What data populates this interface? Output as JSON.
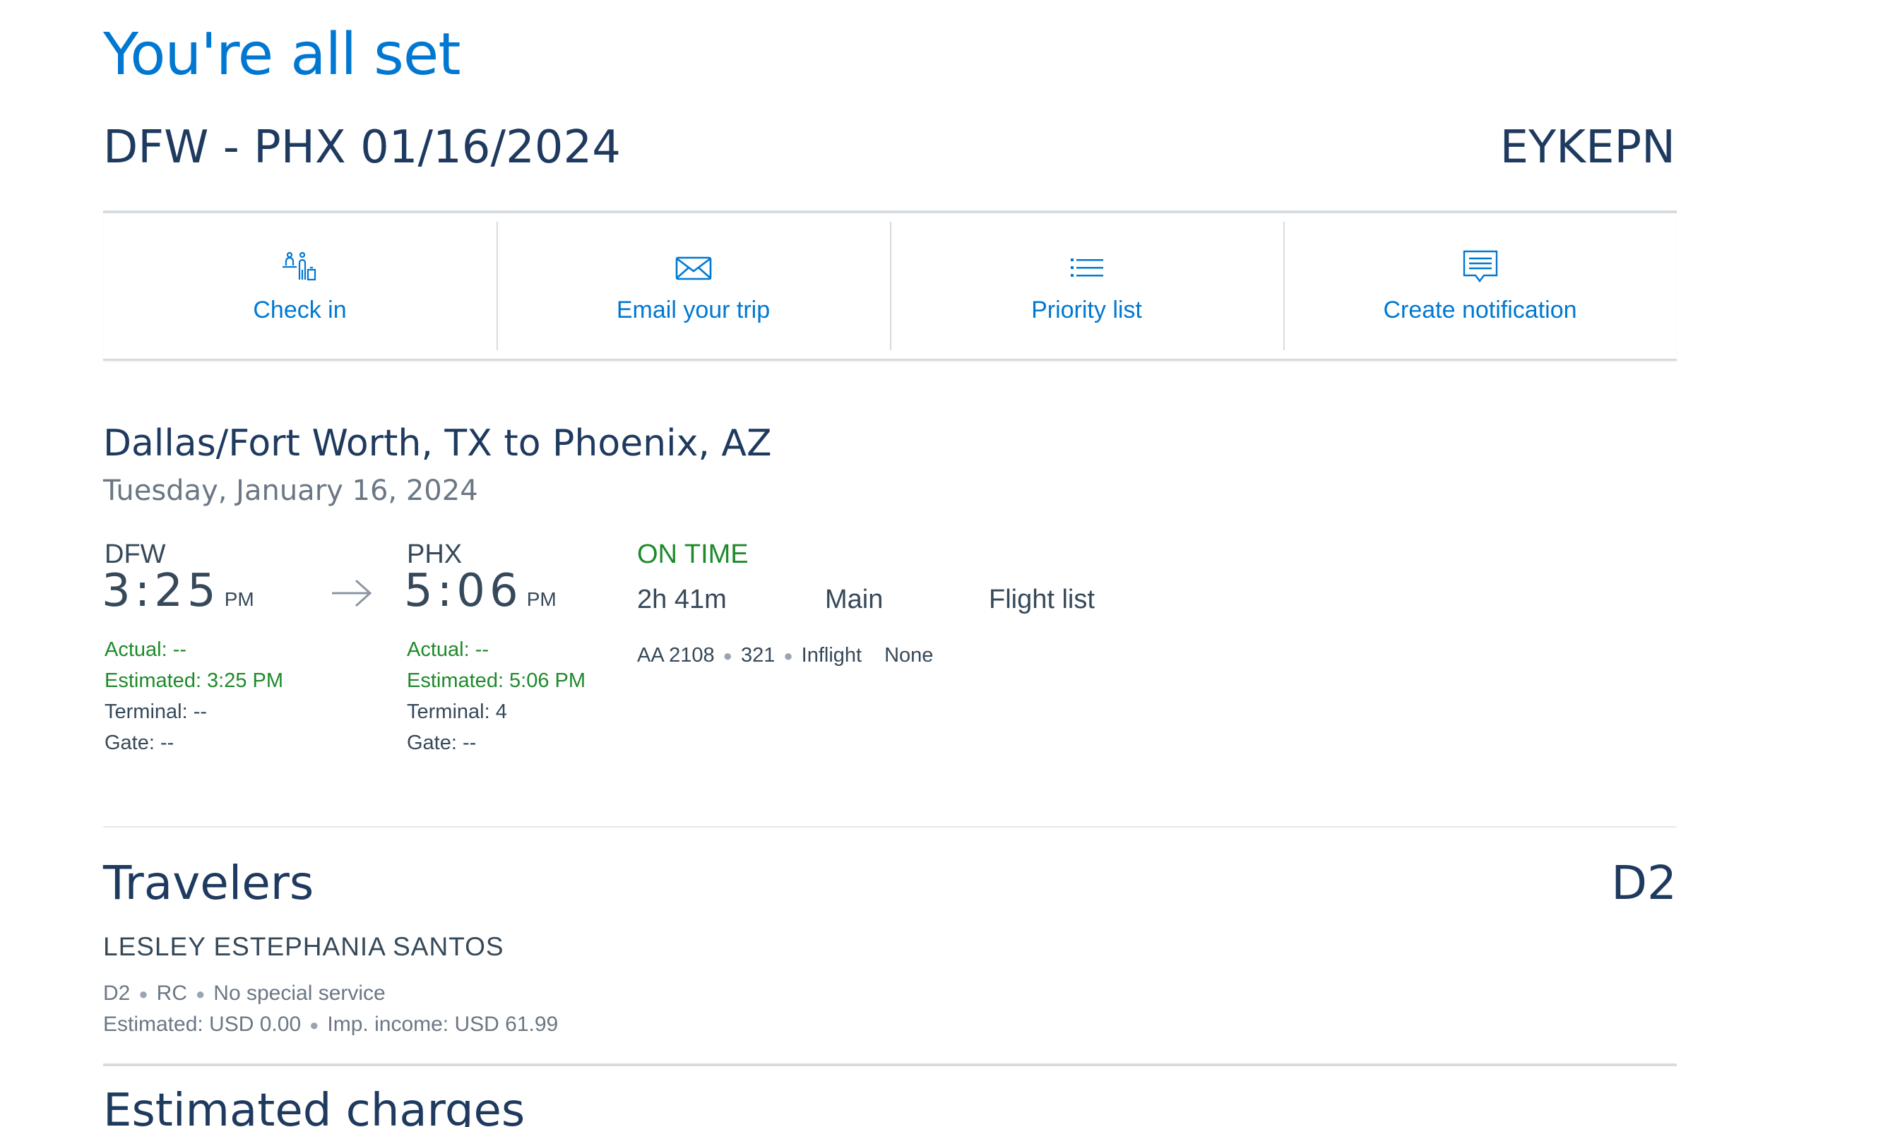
{
  "page_title": "You're all set",
  "trip": {
    "route_date": "DFW - PHX 01/16/2024",
    "record_locator": "EYKEPN"
  },
  "actions": [
    {
      "label": "Check in",
      "icon": "check-in-icon"
    },
    {
      "label": "Email your trip",
      "icon": "envelope-icon"
    },
    {
      "label": "Priority list",
      "icon": "list-icon"
    },
    {
      "label": "Create notification",
      "icon": "notification-icon"
    }
  ],
  "colors": {
    "accent": "#0078d2",
    "heading": "#1e3a5f",
    "status_green": "#1e8a2a",
    "divider": "#d6dbe0"
  },
  "segment": {
    "title": "Dallas/Fort Worth, TX to Phoenix, AZ",
    "date": "Tuesday, January 16, 2024",
    "origin": {
      "code": "DFW",
      "time": "3:25",
      "ampm": "PM",
      "actual": "Actual: --",
      "estimated": "Estimated: 3:25 PM",
      "terminal": "Terminal: --",
      "gate": "Gate: --"
    },
    "destination": {
      "code": "PHX",
      "time": "5:06",
      "ampm": "PM",
      "actual": "Actual: --",
      "estimated": "Estimated: 5:06 PM",
      "terminal": "Terminal: 4",
      "gate": "Gate: --"
    },
    "status": "ON TIME",
    "duration": "2h 41m",
    "cabin": "Main",
    "flight_list_label": "Flight list",
    "flight_number": "AA 2108",
    "aircraft": "321",
    "inflight_label": "Inflight",
    "inflight_value": "None"
  },
  "travelers": {
    "title": "Travelers",
    "seat_summary": "D2",
    "list": [
      {
        "name": "LESLEY ESTEPHANIA SANTOS",
        "seat": "D2",
        "code": "RC",
        "service": "No special service",
        "estimated": "Estimated: USD 0.00",
        "imp_income": "Imp. income: USD 61.99"
      }
    ]
  },
  "charges": {
    "title": "Estimated charges"
  }
}
